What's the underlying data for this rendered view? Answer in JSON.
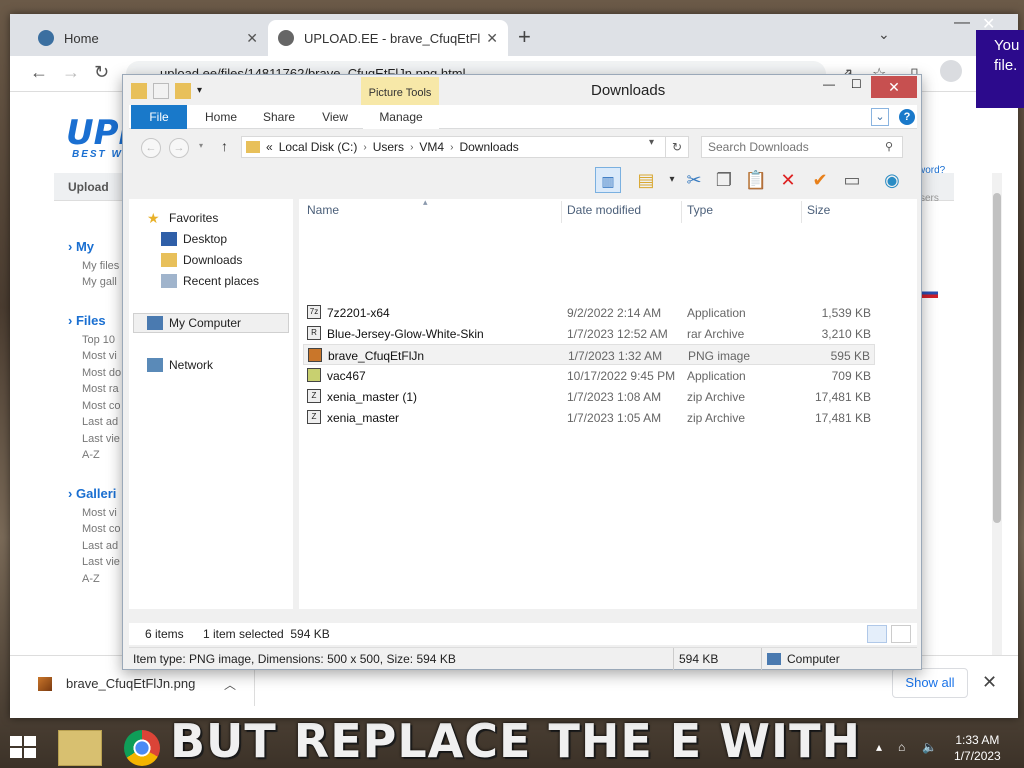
{
  "meme": {
    "bottom_text": "BUT REPLACE THE E WITH AN"
  },
  "browser": {
    "tabs": [
      {
        "label": "Home",
        "icon": "wordpress-icon",
        "active": false
      },
      {
        "label": "UPLOAD.EE - brave_CfuqEtFlJn.p",
        "icon": "globe-icon",
        "active": true
      }
    ],
    "url": "upload.ee/files/14811762/brave_CfuqEtFlJn.png.html"
  },
  "page": {
    "logo_text": "UPL",
    "logo_sub": "BEST W",
    "upload_label": "Upload",
    "sections": [
      {
        "title": "My",
        "links": [
          "My files",
          "My gall"
        ]
      },
      {
        "title": "Files",
        "links": [
          "Top 10",
          "Most vi",
          "Most do",
          "Most ra",
          "Most co",
          "Last ad",
          "Last vie",
          "A-Z"
        ]
      },
      {
        "title": "Galleri",
        "links": [
          "Most vi",
          "Most co",
          "Last ad",
          "Last vie",
          "A-Z"
        ]
      }
    ],
    "right_link_1": "word?",
    "right_link_2": "sers"
  },
  "notification": {
    "text": "You file."
  },
  "download_bar": {
    "file": "brave_CfuqEtFlJn.png",
    "show_all": "Show all"
  },
  "explorer": {
    "title": "Downloads",
    "context_tab": "Picture Tools",
    "ribbon_tabs": [
      "File",
      "Home",
      "Share",
      "View",
      "Manage"
    ],
    "breadcrumb": [
      "Local Disk (C:)",
      "Users",
      "VM4",
      "Downloads"
    ],
    "breadcrumb_prefix": "«",
    "search_placeholder": "Search Downloads",
    "nav": {
      "favorites": "Favorites",
      "desktop": "Desktop",
      "downloads": "Downloads",
      "recent": "Recent places",
      "computer": "My Computer",
      "network": "Network"
    },
    "columns": [
      "Name",
      "Date modified",
      "Type",
      "Size"
    ],
    "files": [
      {
        "name": "7z2201-x64",
        "date": "9/2/2022 2:14 AM",
        "type": "Application",
        "size": "1,539 KB",
        "icon": "7z-icon"
      },
      {
        "name": "Blue-Jersey-Glow-White-Skin",
        "date": "1/7/2023 12:52 AM",
        "type": "rar Archive",
        "size": "3,210 KB",
        "icon": "rar-icon"
      },
      {
        "name": "brave_CfuqEtFlJn",
        "date": "1/7/2023 1:32 AM",
        "type": "PNG image",
        "size": "595 KB",
        "icon": "png-icon",
        "selected": true
      },
      {
        "name": "vac467",
        "date": "10/17/2022 9:45 PM",
        "type": "Application",
        "size": "709 KB",
        "icon": "app-icon"
      },
      {
        "name": "xenia_master (1)",
        "date": "1/7/2023 1:08 AM",
        "type": "zip Archive",
        "size": "17,481 KB",
        "icon": "zip-icon"
      },
      {
        "name": "xenia_master",
        "date": "1/7/2023 1:05 AM",
        "type": "zip Archive",
        "size": "17,481 KB",
        "icon": "zip-icon"
      }
    ],
    "status_count": "6 items",
    "status_selected": "1 item selected  594 KB",
    "details_text": "Item type: PNG image, Dimensions: 500 x 500, Size: 594 KB",
    "details_size": "594 KB",
    "details_location": "Computer"
  },
  "taskbar": {
    "time": "1:33 AM",
    "date": "1/7/2023"
  }
}
